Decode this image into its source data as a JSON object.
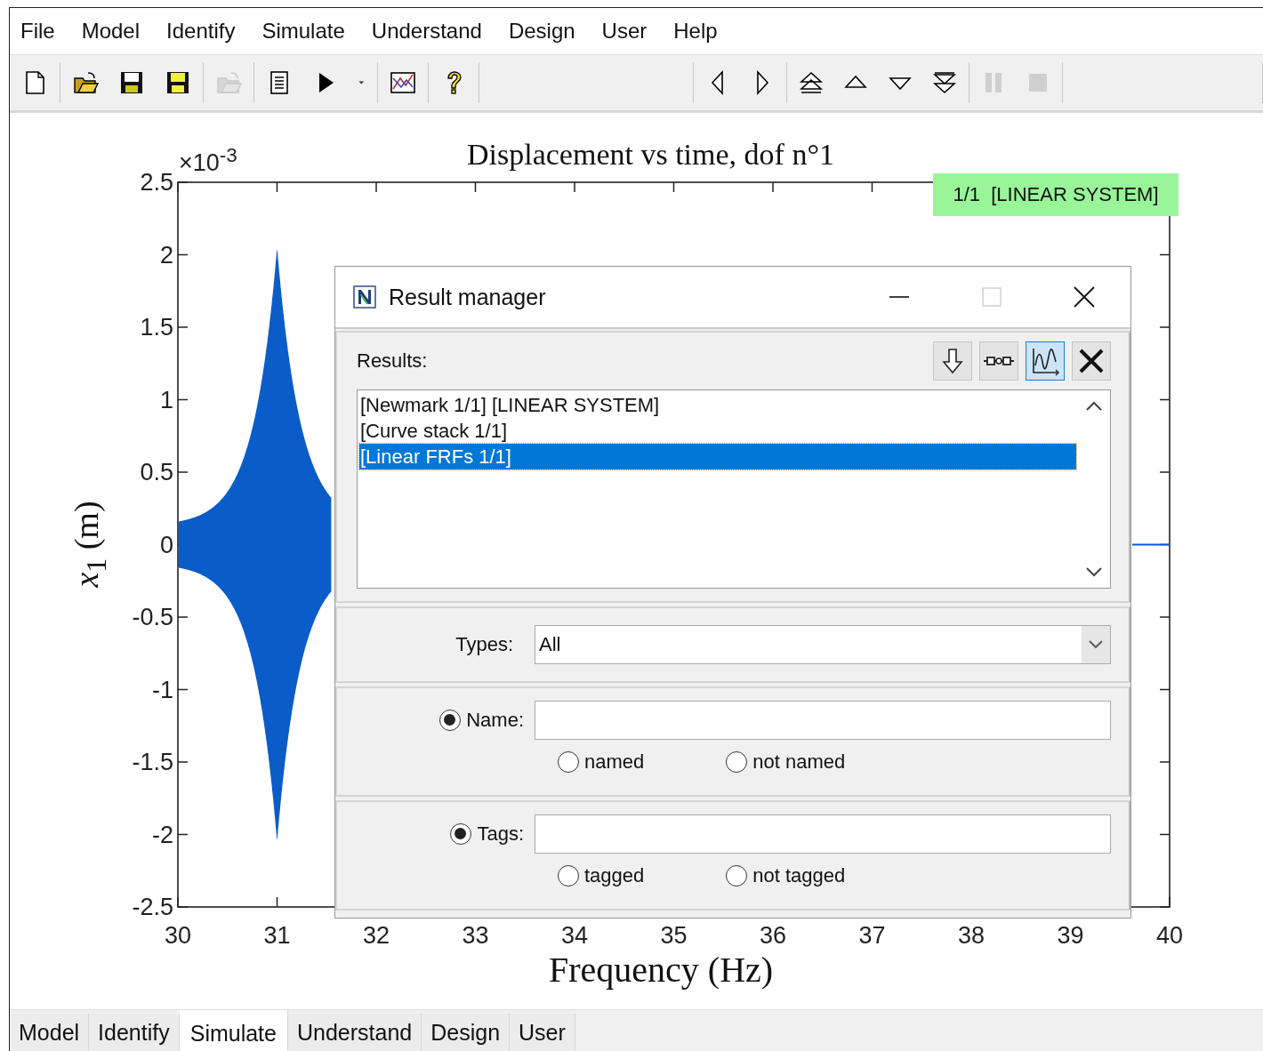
{
  "menu": [
    "File",
    "Model",
    "Identify",
    "Simulate",
    "Understand",
    "Design",
    "User",
    "Help"
  ],
  "toolbar_left": [
    [
      {
        "kind": "new",
        "disabled": false
      }
    ],
    [
      {
        "kind": "open",
        "disabled": false
      },
      {
        "kind": "save",
        "disabled": false
      },
      {
        "kind": "save_as",
        "disabled": false
      }
    ],
    [
      {
        "kind": "open",
        "disabled": true
      }
    ],
    [
      {
        "kind": "document",
        "disabled": false
      },
      {
        "kind": "play",
        "disabled": false
      },
      {
        "kind": "caret",
        "disabled": false
      }
    ],
    [
      {
        "kind": "chart",
        "disabled": false
      }
    ],
    [
      {
        "kind": "help",
        "disabled": false
      }
    ]
  ],
  "toolbar_right": [
    [
      {
        "kind": "left",
        "disabled": false
      },
      {
        "kind": "right",
        "disabled": false
      }
    ],
    [
      {
        "kind": "first",
        "disabled": false
      },
      {
        "kind": "up",
        "disabled": false
      },
      {
        "kind": "down",
        "disabled": false
      },
      {
        "kind": "last",
        "disabled": false
      }
    ],
    [
      {
        "kind": "pause",
        "disabled": true
      },
      {
        "kind": "stop",
        "disabled": true
      }
    ]
  ],
  "plot": {
    "title": "Displacement vs time, dof n°1",
    "exponent": "×10$^{-3}$",
    "xlabel": "Frequency (Hz)",
    "ylabel": "*x*$_{1}$ (m)",
    "xticks": [
      "30",
      "31",
      "32",
      "33",
      "34",
      "35",
      "36",
      "37",
      "38",
      "39",
      "40"
    ],
    "yticks": [
      "2.5",
      "2",
      "1.5",
      "1",
      "0.5",
      "0",
      "-0.5",
      "-1",
      "-1.5",
      "-2",
      "-2.5"
    ],
    "badge": "1/1  [LINEAR SYSTEM]"
  },
  "dialog": {
    "title": "Result manager",
    "results_label": "Results:",
    "tools": [
      {
        "kind": "down",
        "on": false
      },
      {
        "kind": "link",
        "on": false
      },
      {
        "kind": "plot",
        "on": true
      },
      {
        "kind": "delete",
        "on": false
      }
    ],
    "results": [
      {
        "label": "[Newmark 1/1] [LINEAR SYSTEM]",
        "selected": false
      },
      {
        "label": "[Curve stack 1/1]",
        "selected": false
      },
      {
        "label": "[Linear FRFs 1/1]",
        "selected": true
      }
    ],
    "types_label": "Types:",
    "types_value": "All",
    "filters": [
      {
        "label": "Name:",
        "checked": true,
        "options": [
          {
            "label": "named",
            "checked": false
          },
          {
            "label": "not named",
            "checked": false
          }
        ]
      },
      {
        "label": "Tags:",
        "checked": true,
        "options": [
          {
            "label": "tagged",
            "checked": false
          },
          {
            "label": "not tagged",
            "checked": false
          }
        ]
      }
    ]
  },
  "tabs": [
    {
      "label": "Model",
      "selected": false
    },
    {
      "label": "Identify",
      "selected": false
    },
    {
      "label": "Simulate",
      "selected": true
    },
    {
      "label": "Understand",
      "selected": false
    },
    {
      "label": "Design",
      "selected": false
    },
    {
      "label": "User",
      "selected": false
    }
  ]
}
